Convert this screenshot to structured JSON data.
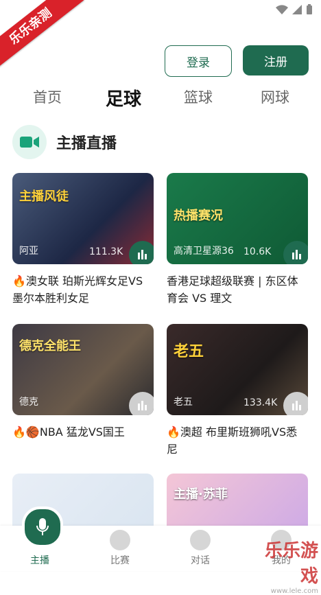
{
  "ribbon": {
    "text": "乐乐亲测"
  },
  "auth": {
    "login": "登录",
    "register": "注册"
  },
  "tabs": [
    {
      "label": "首页"
    },
    {
      "label": "足球"
    },
    {
      "label": "篮球"
    },
    {
      "label": "网球"
    }
  ],
  "section": {
    "title": "主播直播"
  },
  "cards": [
    {
      "bigtext": "主播风徒",
      "tag": "阿亚",
      "views": "111.3K",
      "title": "🔥澳女联 珀斯光辉女足VS墨尔本胜利女足"
    },
    {
      "bigtext": "热播赛况",
      "tag": "高清卫星源36",
      "views": "10.6K",
      "title": "香港足球超级联赛 | 东区体育会 VS 理文"
    },
    {
      "bigtext": "德克全能王",
      "tag": "德克",
      "views": "",
      "title": "🔥🏀NBA 猛龙VS国王"
    },
    {
      "bigtext": "老五",
      "tag": "老五",
      "views": "133.4K",
      "title": "🔥澳超 布里斯班狮吼VS悉尼"
    },
    {
      "bigtext": "",
      "tag": "",
      "views": "",
      "title": ""
    },
    {
      "bigtext": "主播·苏菲",
      "tag": "",
      "views": "",
      "title": ""
    }
  ],
  "nav": [
    {
      "label": "主播"
    },
    {
      "label": "比赛"
    },
    {
      "label": "对话"
    },
    {
      "label": "我的"
    }
  ],
  "watermark": {
    "title": "乐乐游戏",
    "url": "www.lele.com"
  }
}
